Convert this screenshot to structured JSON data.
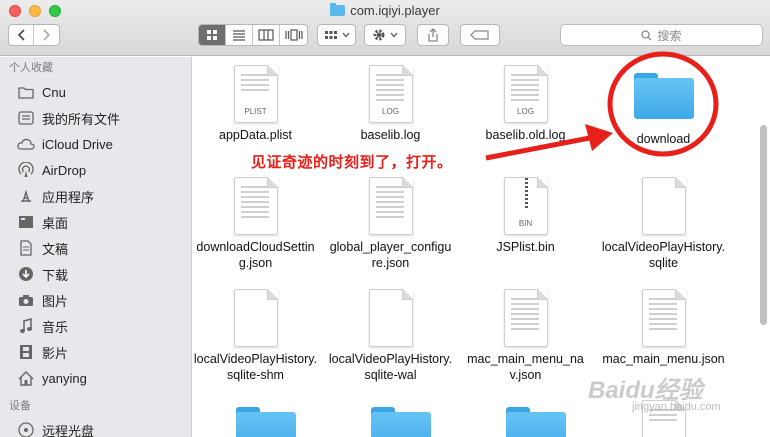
{
  "window": {
    "title": "com.iqiyi.player"
  },
  "toolbar": {
    "search_placeholder": "搜索"
  },
  "sidebar": {
    "favorites_header": "个人收藏",
    "favorites": [
      {
        "label": "Cnu",
        "icon": "folder-icon"
      },
      {
        "label": "我的所有文件",
        "icon": "all-files-icon"
      },
      {
        "label": "iCloud Drive",
        "icon": "cloud-icon"
      },
      {
        "label": "AirDrop",
        "icon": "airdrop-icon"
      },
      {
        "label": "应用程序",
        "icon": "applications-icon"
      },
      {
        "label": "桌面",
        "icon": "desktop-icon"
      },
      {
        "label": "文稿",
        "icon": "documents-icon"
      },
      {
        "label": "下载",
        "icon": "download-icon"
      },
      {
        "label": "图片",
        "icon": "camera-icon"
      },
      {
        "label": "音乐",
        "icon": "music-icon"
      },
      {
        "label": "影片",
        "icon": "film-icon"
      },
      {
        "label": "yanying",
        "icon": "home-icon"
      }
    ],
    "devices_header": "设备",
    "devices": [
      {
        "label": "远程光盘",
        "icon": "disc-icon"
      }
    ]
  },
  "files": [
    {
      "name": "appData.plist",
      "kind": "doc",
      "tag": "PLIST"
    },
    {
      "name": "baselib.log",
      "kind": "doc",
      "tag": "LOG"
    },
    {
      "name": "baselib.old.log",
      "kind": "doc",
      "tag": "LOG"
    },
    {
      "name": "download",
      "kind": "folder",
      "tag": ""
    },
    {
      "name": "downloadCloudSetting.json",
      "kind": "doc",
      "tag": ""
    },
    {
      "name": "global_player_configure.json",
      "kind": "doc",
      "tag": ""
    },
    {
      "name": "JSPlist.bin",
      "kind": "zip",
      "tag": "BIN"
    },
    {
      "name": "localVideoPlayHistory.sqlite",
      "kind": "blank",
      "tag": ""
    },
    {
      "name": "localVideoPlayHistory.sqlite-shm",
      "kind": "blank",
      "tag": ""
    },
    {
      "name": "localVideoPlayHistory.sqlite-wal",
      "kind": "blank",
      "tag": ""
    },
    {
      "name": "mac_main_menu_nav.json",
      "kind": "doc",
      "tag": ""
    },
    {
      "name": "mac_main_menu.json",
      "kind": "doc",
      "tag": ""
    },
    {
      "name": "",
      "kind": "folder",
      "tag": ""
    },
    {
      "name": "",
      "kind": "folder",
      "tag": ""
    },
    {
      "name": "",
      "kind": "folder",
      "tag": ""
    },
    {
      "name": "",
      "kind": "doc",
      "tag": ""
    }
  ],
  "annotation": {
    "text": "见证奇迹的时刻到了，打开。"
  },
  "watermark": {
    "brand": "Baidu经验",
    "url": "jingyan.baidu.com"
  },
  "colors": {
    "annotation_red": "#e8201a",
    "folder_blue": "#4fb3ee",
    "sidebar_bg": "#e8e8ec"
  }
}
